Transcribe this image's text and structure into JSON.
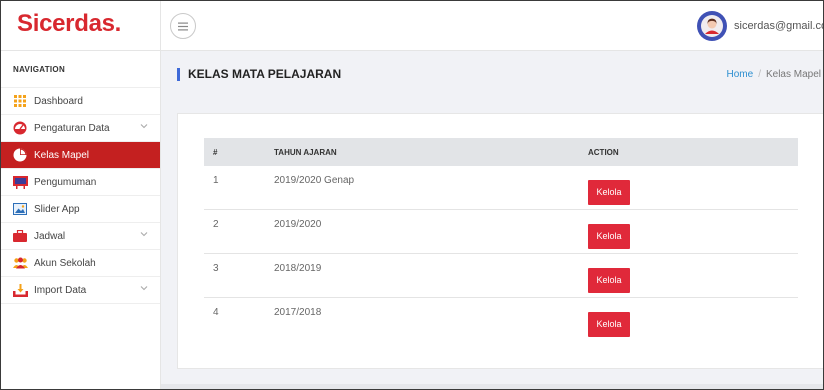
{
  "brand": "Sicerdas.",
  "header": {
    "user_email": "sicerdas@gmail.com"
  },
  "sidebar": {
    "title": "NAVIGATION",
    "items": [
      {
        "label": "Dashboard",
        "icon": "grid-icon",
        "active": false,
        "expandable": false
      },
      {
        "label": "Pengaturan Data",
        "icon": "dashboard-icon",
        "active": false,
        "expandable": true
      },
      {
        "label": "Kelas Mapel",
        "icon": "pie-chart-icon",
        "active": true,
        "expandable": false
      },
      {
        "label": "Pengumuman",
        "icon": "board-icon",
        "active": false,
        "expandable": false
      },
      {
        "label": "Slider App",
        "icon": "image-icon",
        "active": false,
        "expandable": false
      },
      {
        "label": "Jadwal",
        "icon": "briefcase-icon",
        "active": false,
        "expandable": true
      },
      {
        "label": "Akun Sekolah",
        "icon": "users-icon",
        "active": false,
        "expandable": false
      },
      {
        "label": "Import Data",
        "icon": "download-tray-icon",
        "active": false,
        "expandable": true
      }
    ]
  },
  "page": {
    "title": "KELAS MATA PELAJARAN",
    "breadcrumb": {
      "home": "Home",
      "separator": "/",
      "current": "Kelas Mapel"
    }
  },
  "table": {
    "headers": {
      "num": "#",
      "year": "TAHUN AJARAN",
      "action": "ACTION"
    },
    "rows": [
      {
        "num": "1",
        "year": "2019/2020 Genap",
        "action": "Kelola"
      },
      {
        "num": "2",
        "year": "2019/2020",
        "action": "Kelola"
      },
      {
        "num": "3",
        "year": "2018/2019",
        "action": "Kelola"
      },
      {
        "num": "4",
        "year": "2017/2018",
        "action": "Kelola"
      }
    ]
  },
  "colors": {
    "brand": "#d8282f",
    "active": "#c42020",
    "button": "#e0293a",
    "title_bar": "#3f6ad8",
    "link": "#2d8fd0"
  }
}
